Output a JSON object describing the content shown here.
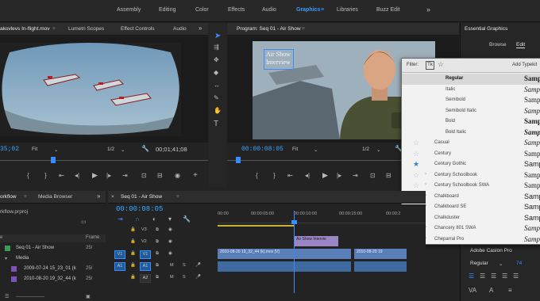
{
  "workspaces": {
    "items": [
      "Assembly",
      "Editing",
      "Color",
      "Effects",
      "Audio",
      "Graphics",
      "Libraries",
      "Buzz Edit"
    ],
    "active": "Graphics",
    "overflow": "»"
  },
  "source": {
    "tabs": [
      "akovlevs In-flight.mov",
      "Lumetri Scopes",
      "Effect Controls",
      "Audio"
    ],
    "overflow": "»",
    "timecode": "35;02",
    "fit": "Fit",
    "resolution": "1/2",
    "duration": "00;01;41;08"
  },
  "program": {
    "title": "Program: Seq 01 - Air Show",
    "timecode": "00:00:08:05",
    "fit": "Fit",
    "resolution": "1/2",
    "title_text": "Air Show Interview"
  },
  "essential": {
    "title": "Essential Graphics",
    "tabs": [
      "Browse",
      "Edit"
    ],
    "add_typekit": "Add Typekit",
    "font": "Adobe Caslon Pro",
    "style": "Regular",
    "size": "74"
  },
  "font_menu": {
    "filter_label": "Filter:",
    "sample": "Sample",
    "rows": [
      {
        "name": "Regular",
        "indent": true,
        "selected": true,
        "star": false
      },
      {
        "name": "Italic",
        "indent": true,
        "star": false
      },
      {
        "name": "Semibold",
        "indent": true,
        "star": false
      },
      {
        "name": "Semibold Italic",
        "indent": true,
        "star": false
      },
      {
        "name": "Bold",
        "indent": true,
        "star": false
      },
      {
        "name": "Bold Italic",
        "indent": true,
        "star": false
      },
      {
        "name": "Casual",
        "indent": false,
        "star": true
      },
      {
        "name": "Century",
        "indent": false,
        "star": true
      },
      {
        "name": "Century Gothic",
        "indent": false,
        "star": true,
        "favorite": true
      },
      {
        "name": "Century Schoolbook",
        "indent": false,
        "star": true,
        "arrow": true
      },
      {
        "name": "Century Schoolbook SWA",
        "indent": false,
        "star": true,
        "arrow": true
      },
      {
        "name": "Chalkboard",
        "indent": false,
        "star": true,
        "arrow": true
      },
      {
        "name": "Chalkboard SE",
        "indent": false,
        "star": true,
        "arrow": true
      },
      {
        "name": "Chalkduster",
        "indent": false,
        "star": true
      },
      {
        "name": "Chancery 801 SWA",
        "indent": false,
        "star": true,
        "arrow": true
      },
      {
        "name": "Cheparral Pro",
        "indent": false,
        "star": true,
        "arrow": true
      }
    ]
  },
  "project": {
    "tabs": [
      "orkflow",
      "Media Browser"
    ],
    "overflow": "»",
    "file": "rkflow.prproj",
    "col_name": "e",
    "col_frame": "Frame",
    "items": [
      {
        "name": "Seq 01 - Air Show",
        "rate": "25/"
      },
      {
        "name": "Media",
        "rate": ""
      },
      {
        "name": "2009-07-24 15_23_01 (k",
        "rate": "25/"
      },
      {
        "name": "2010-08-20 19_32_44 (k",
        "rate": "25/"
      }
    ]
  },
  "timeline": {
    "tab": "Seq 01 - Air Show",
    "timecode": "00:00:08:05",
    "ruler": [
      "00:00",
      "00:00:05:00",
      "00:00:10:00",
      "00:00:15:00",
      "00:00:2"
    ],
    "tracks": {
      "v3": "V3",
      "v2": "V2",
      "v1": "V1",
      "a1": "A1",
      "a2": "A2",
      "m": "M",
      "s": "S"
    },
    "clips": {
      "title": "Air Show Intervie",
      "video1": "2010-08-20 19_32_44 (k).mov [V]",
      "video2": "2010-08-20 19"
    }
  }
}
